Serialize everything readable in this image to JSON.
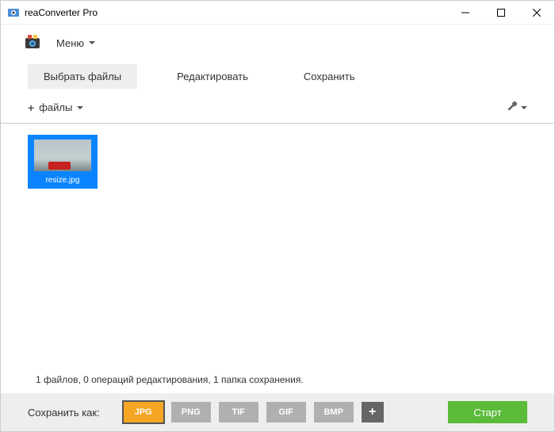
{
  "window": {
    "title": "reaConverter Pro"
  },
  "menu": {
    "label": "Меню"
  },
  "tabs": {
    "select": "Выбрать файлы",
    "edit": "Редактировать",
    "save": "Сохранить"
  },
  "toolbar": {
    "files": "файлы"
  },
  "file": {
    "name": "resize.jpg"
  },
  "status": {
    "text": "1 файлов, 0 операций редактирования, 1 папка сохранения."
  },
  "bottom": {
    "save_as": "Сохранить как:",
    "formats": {
      "jpg": "JPG",
      "png": "PNG",
      "tif": "TIF",
      "gif": "GIF",
      "bmp": "BMP",
      "add": "+"
    },
    "start": "Старт"
  }
}
